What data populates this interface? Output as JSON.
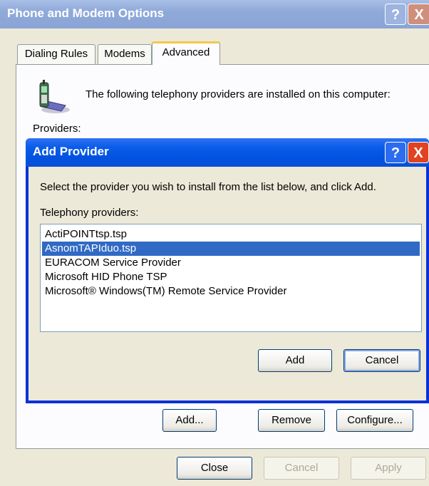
{
  "window": {
    "title": "Phone and Modem Options",
    "help_glyph": "?",
    "close_glyph": "X"
  },
  "tabs": [
    {
      "label": "Dialing Rules",
      "active": false
    },
    {
      "label": "Modems",
      "active": false
    },
    {
      "label": "Advanced",
      "active": true
    }
  ],
  "advanced": {
    "intro": "The following telephony providers are installed on this computer:",
    "providers_label": "Providers:",
    "buttons": {
      "add": "Add...",
      "remove": "Remove",
      "configure": "Configure..."
    }
  },
  "footer": {
    "close": "Close",
    "cancel": "Cancel",
    "apply": "Apply"
  },
  "dialog": {
    "title": "Add Provider",
    "instruction": "Select the provider you wish to install from the list below, and click Add.",
    "list_label": "Telephony providers:",
    "items": [
      "ActiPOINTtsp.tsp",
      "AsnomTAPIduo.tsp",
      "EURACOM Service Provider",
      "Microsoft HID Phone TSP",
      "Microsoft® Windows(TM) Remote Service Provider"
    ],
    "selected_index": 1,
    "add": "Add",
    "cancel": "Cancel"
  },
  "colors": {
    "active_title": "#0252e0",
    "inactive_title": "#8fa9d9",
    "selection": "#316ac5",
    "tab_highlight": "#f2c94a"
  }
}
